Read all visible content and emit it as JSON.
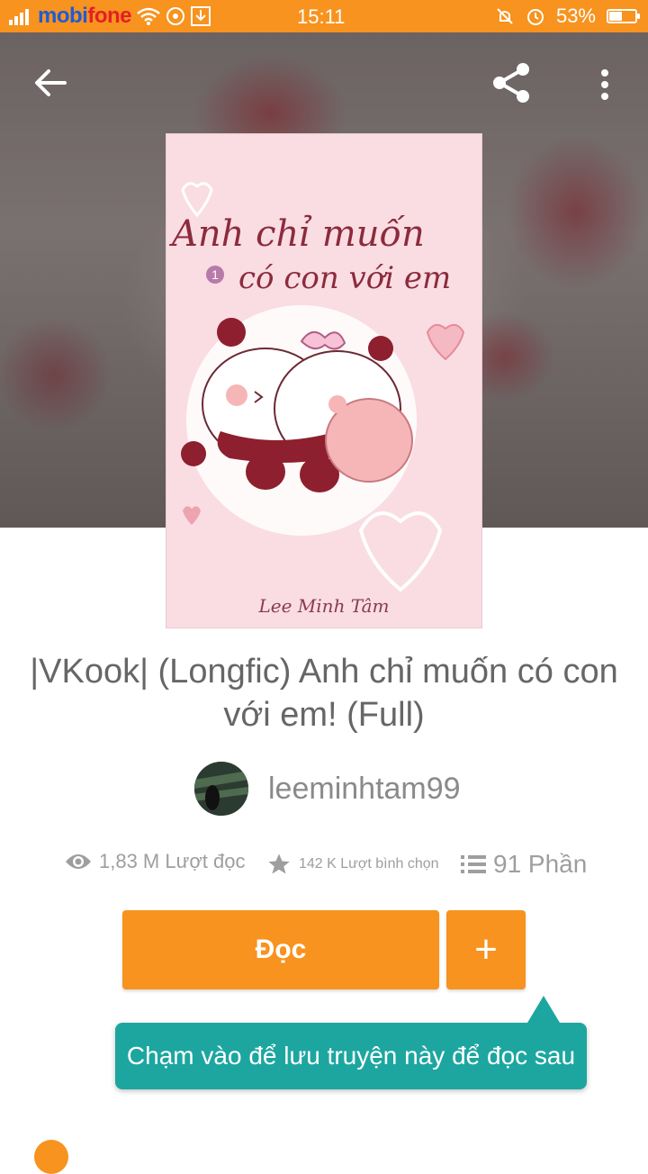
{
  "status_bar": {
    "carrier_part1": "mobi",
    "carrier_part2": "fone",
    "time": "15:11",
    "battery": "53%",
    "battery_level": 0.53,
    "icons": [
      "signal-icon",
      "wifi-icon",
      "notification-icon",
      "download-icon",
      "mute-icon",
      "alarm-icon",
      "battery-icon"
    ]
  },
  "toolbar": {
    "back_icon": "arrow-left-icon",
    "share_icon": "share-icon",
    "more_icon": "more-vert-icon"
  },
  "cover": {
    "title_line1": "Anh chỉ muốn",
    "title_line2": "có con với em",
    "volume": "1",
    "author": "Lee Minh Tâm",
    "bg_color": "#f9dde3"
  },
  "story": {
    "title": "|VKook| (Longfic) Anh chỉ muốn có con với em! (Full)",
    "author": "leeminhtam99"
  },
  "stats": {
    "reads": "1,83 M Lượt đọc",
    "votes": "142 K Lượt bình chọn",
    "parts": "91 Phần"
  },
  "actions": {
    "read_label": "Đọc",
    "add_label": "+"
  },
  "tooltip": {
    "text": "Chạm vào để lưu truyện này để đọc sau"
  },
  "colors": {
    "accent": "#f7931e",
    "tooltip": "#1da6a0"
  }
}
